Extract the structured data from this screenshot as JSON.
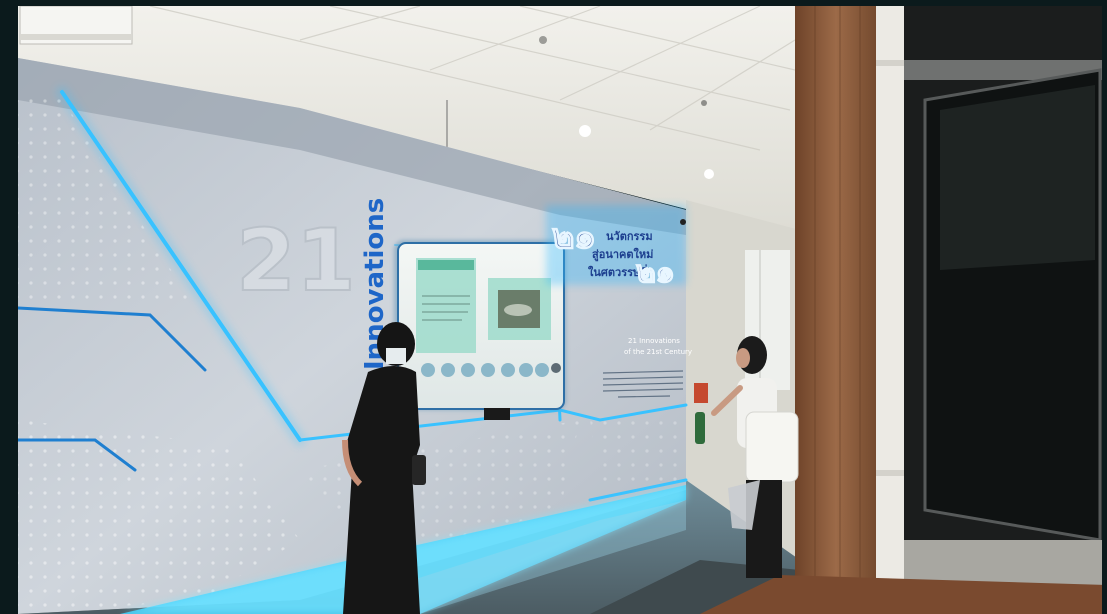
{
  "scene": {
    "big_number": "21",
    "vertical_word": "Innovations",
    "thai_title": {
      "numeral_left": "๒๑",
      "line1": "นวัตกรรม",
      "line2": "สู่อนาคตใหม่",
      "line3": "ในศตวรรษที่",
      "numeral_right": "๒๑"
    },
    "english_title": [
      "21 Innovations",
      "of the 21st Century"
    ]
  },
  "colors": {
    "wall_glow": "#2fb8ff",
    "panel_grey": "#c9d0d8",
    "ceiling": "#e9e8e2",
    "wood": "#8a5a3c",
    "title_blue": "#1d3f8f"
  }
}
